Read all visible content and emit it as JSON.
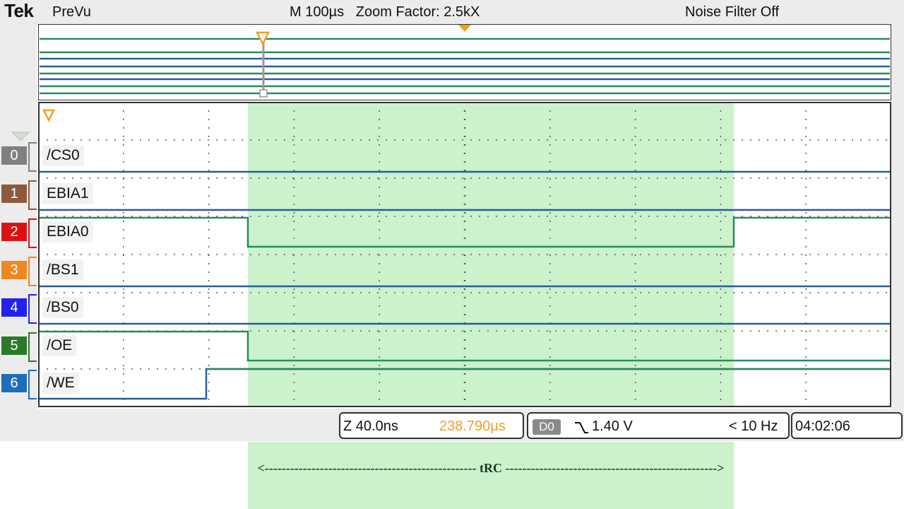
{
  "header": {
    "brand": "Tek",
    "mode": "PreVu",
    "timebase": "M 100µs",
    "zoom": "Zoom Factor: 2.5kX",
    "noise_filter": "Noise Filter Off"
  },
  "channels": [
    {
      "num": "0",
      "label": "/CS0",
      "color": "#808080"
    },
    {
      "num": "1",
      "label": "EBIA1",
      "color": "#8b5a3c"
    },
    {
      "num": "2",
      "label": "EBIA0",
      "color": "#dd1111"
    },
    {
      "num": "3",
      "label": "/BS1",
      "color": "#ee8822"
    },
    {
      "num": "4",
      "label": "/BS0",
      "color": "#2222ee"
    },
    {
      "num": "5",
      "label": "/OE",
      "color": "#2a7a2a"
    },
    {
      "num": "6",
      "label": "/WE",
      "color": "#1e6eb8"
    }
  ],
  "status": {
    "zoom_time": "Z 40.0ns",
    "position": "238.790µs",
    "trigger_source": "D0",
    "trigger_level": "1.40 V",
    "trigger_freq": "< 10 Hz",
    "clock": "04:02:06"
  },
  "annotation": {
    "trc_label": "<-------------------------------------------------- tRC -------------------------------------------------->"
  },
  "colors": {
    "highlight": "#ccf2cc",
    "trace_blue": "#2a5aa0",
    "trace_green": "#2a8a5a",
    "position_orange": "#f0a020"
  }
}
